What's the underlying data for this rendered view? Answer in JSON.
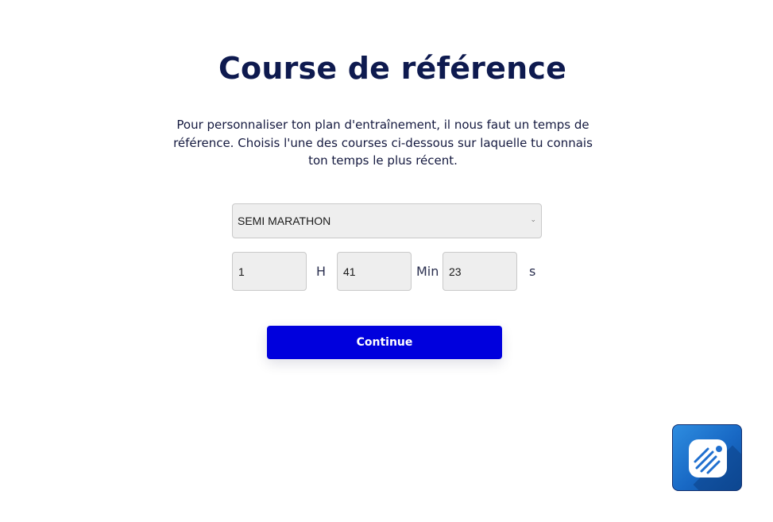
{
  "page": {
    "title": "Course de référence",
    "description": "Pour personnaliser ton plan d'entraînement, il nous faut un temps de référence. Choisis l'une des courses ci-dessous sur laquelle tu connais ton temps le plus récent."
  },
  "race_select": {
    "selected": "SEMI MARATHON",
    "icon": "chevron-down-icon"
  },
  "time": {
    "hours_value": "1",
    "hours_unit": "H",
    "minutes_value": "41",
    "minutes_unit": "Min",
    "seconds_value": "23",
    "seconds_unit": "s"
  },
  "actions": {
    "continue_label": "Continue"
  },
  "app_badge": {
    "icon": "running-app-icon"
  },
  "colors": {
    "title": "#0e1a4f",
    "button": "#0000dd",
    "input_background": "#eeeeee",
    "badge_blue": "#1868c4"
  }
}
